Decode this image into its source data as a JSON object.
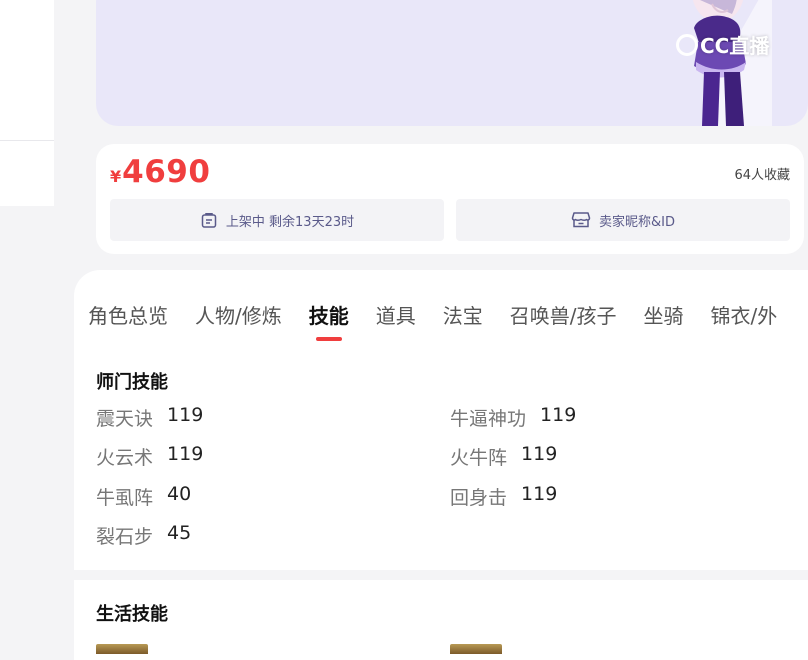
{
  "banner": {
    "watermark": "CC直播"
  },
  "price_card": {
    "currency": "¥",
    "price": "4690",
    "favorites": "64人收藏",
    "listing_status": "上架中 剩余13天23时",
    "seller": "卖家昵称&ID"
  },
  "tabs": [
    {
      "label": "角色总览"
    },
    {
      "label": "人物/修炼"
    },
    {
      "label": "技能"
    },
    {
      "label": "道具"
    },
    {
      "label": "法宝"
    },
    {
      "label": "召唤兽/孩子"
    },
    {
      "label": "坐骑"
    },
    {
      "label": "锦衣/外"
    }
  ],
  "active_tab": "技能",
  "sections": {
    "school_skills": {
      "title": "师门技能",
      "skills": [
        {
          "name": "震天诀",
          "level": "119"
        },
        {
          "name": "牛逼神功",
          "level": "119"
        },
        {
          "name": "火云术",
          "level": "119"
        },
        {
          "name": "火牛阵",
          "level": "119"
        },
        {
          "name": "牛虱阵",
          "level": "40"
        },
        {
          "name": "回身击",
          "level": "119"
        },
        {
          "name": "裂石步",
          "level": "45"
        }
      ]
    },
    "life_skills": {
      "title": "生活技能"
    }
  },
  "colors": {
    "accent": "#f03e3e",
    "banner_bg": "#e9e7f9",
    "info_text": "#5a5a8a"
  }
}
